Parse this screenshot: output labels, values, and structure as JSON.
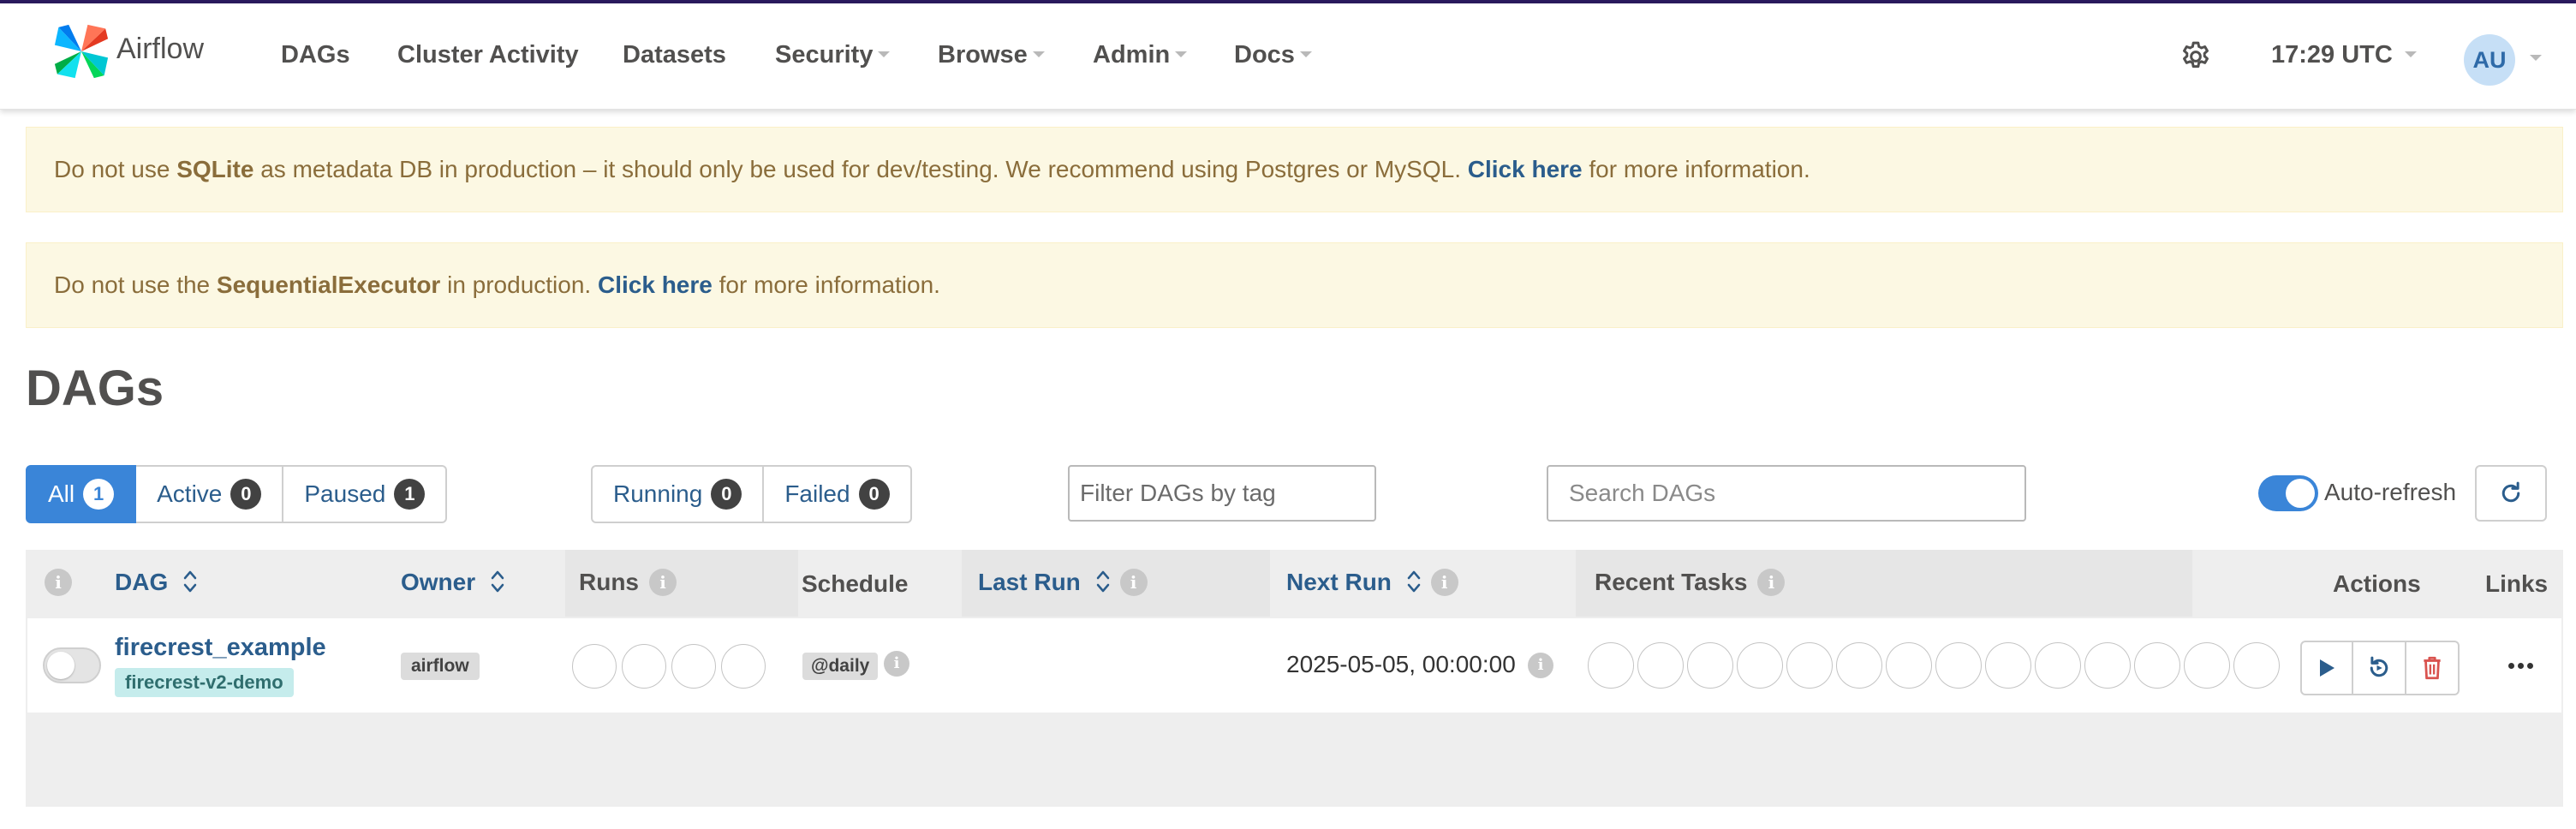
{
  "navbar": {
    "brand": "Airflow",
    "items": [
      {
        "label": "DAGs",
        "dropdown": false
      },
      {
        "label": "Cluster Activity",
        "dropdown": false
      },
      {
        "label": "Datasets",
        "dropdown": false
      },
      {
        "label": "Security",
        "dropdown": true
      },
      {
        "label": "Browse",
        "dropdown": true
      },
      {
        "label": "Admin",
        "dropdown": true
      },
      {
        "label": "Docs",
        "dropdown": true
      }
    ],
    "time": "17:29 UTC",
    "user_initials": "AU",
    "settings_icon": "gear-icon"
  },
  "alerts": [
    {
      "before": "Do not use ",
      "bold": "SQLite",
      "middle": " as metadata DB in production – it should only be used for dev/testing. We recommend using Postgres or MySQL. ",
      "link": "Click here",
      "after": " for more information."
    },
    {
      "before": "Do not use the ",
      "bold": "SequentialExecutor",
      "middle": " in production. ",
      "link": "Click here",
      "after": " for more information."
    }
  ],
  "page_title": "DAGs",
  "status_filters": [
    {
      "label": "All",
      "count": "1",
      "active": true
    },
    {
      "label": "Active",
      "count": "0",
      "active": false
    },
    {
      "label": "Paused",
      "count": "1",
      "active": false
    }
  ],
  "run_filters": [
    {
      "label": "Running",
      "count": "0"
    },
    {
      "label": "Failed",
      "count": "0"
    }
  ],
  "tag_filter": {
    "placeholder": "Filter DAGs by tag"
  },
  "search": {
    "placeholder": "Search DAGs"
  },
  "auto_refresh": {
    "label": "Auto-refresh",
    "enabled": true
  },
  "table": {
    "headers": {
      "dag": "DAG",
      "owner": "Owner",
      "runs": "Runs",
      "schedule": "Schedule",
      "last_run": "Last Run",
      "next_run": "Next Run",
      "recent_tasks": "Recent Tasks",
      "actions": "Actions",
      "links": "Links"
    },
    "rows": [
      {
        "paused": true,
        "dag_id": "firecrest_example",
        "tag": "firecrest-v2-demo",
        "owner": "airflow",
        "runs_circles": 4,
        "schedule": "@daily",
        "last_run": "",
        "next_run": "2025-05-05, 00:00:00",
        "recent_task_circles": 14
      }
    ]
  },
  "colors": {
    "primary": "#3a85d8",
    "link": "#2b5d8c",
    "alert_bg": "#fcf8e3",
    "alert_text": "#8a6d3b",
    "tag_bg": "#c5ecec",
    "delete": "#d9534f"
  }
}
